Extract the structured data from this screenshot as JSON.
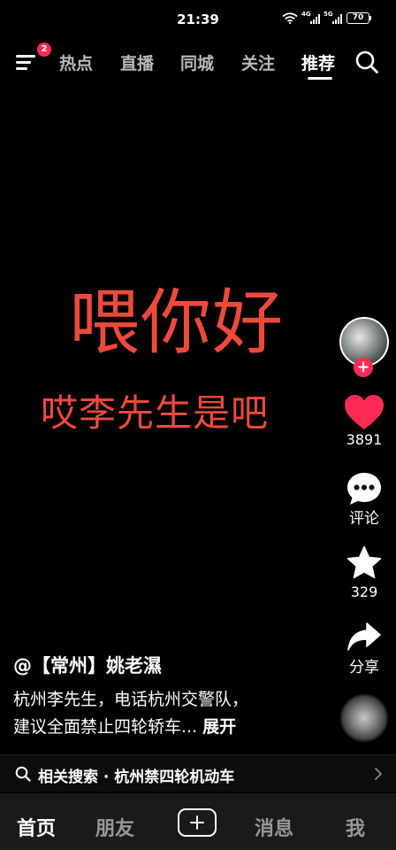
{
  "status": {
    "time": "21:39",
    "net1": "4G",
    "net2": "5G",
    "battery": "70"
  },
  "top_nav": {
    "notification_count": "2",
    "tabs": [
      {
        "label": "热点"
      },
      {
        "label": "直播"
      },
      {
        "label": "同城"
      },
      {
        "label": "关注"
      },
      {
        "label": "推荐",
        "active": true
      }
    ]
  },
  "video": {
    "caption_main": "喂你好",
    "caption_sub": "哎李先生是吧"
  },
  "actions": {
    "like_count": "3891",
    "comment_label": "评论",
    "favorite_count": "329",
    "share_label": "分享"
  },
  "post": {
    "author": "@【常州】姚老濕",
    "desc_line1": "杭州李先生，电话杭州交警队，",
    "desc_line2": "建议全面禁止四轮轿车...",
    "expand_label": "展开"
  },
  "related_search": {
    "text": "相关搜索 · 杭州禁四轮机动车"
  },
  "bottom_nav": {
    "home": "首页",
    "friends": "朋友",
    "messages": "消息",
    "me": "我"
  },
  "colors": {
    "accent": "#fe2c55",
    "caption": "#ee4a3b"
  },
  "icons": [
    "menu-icon",
    "search-icon",
    "heart-icon",
    "comment-icon",
    "star-icon",
    "share-icon",
    "plus-icon",
    "chevron-right-icon"
  ]
}
